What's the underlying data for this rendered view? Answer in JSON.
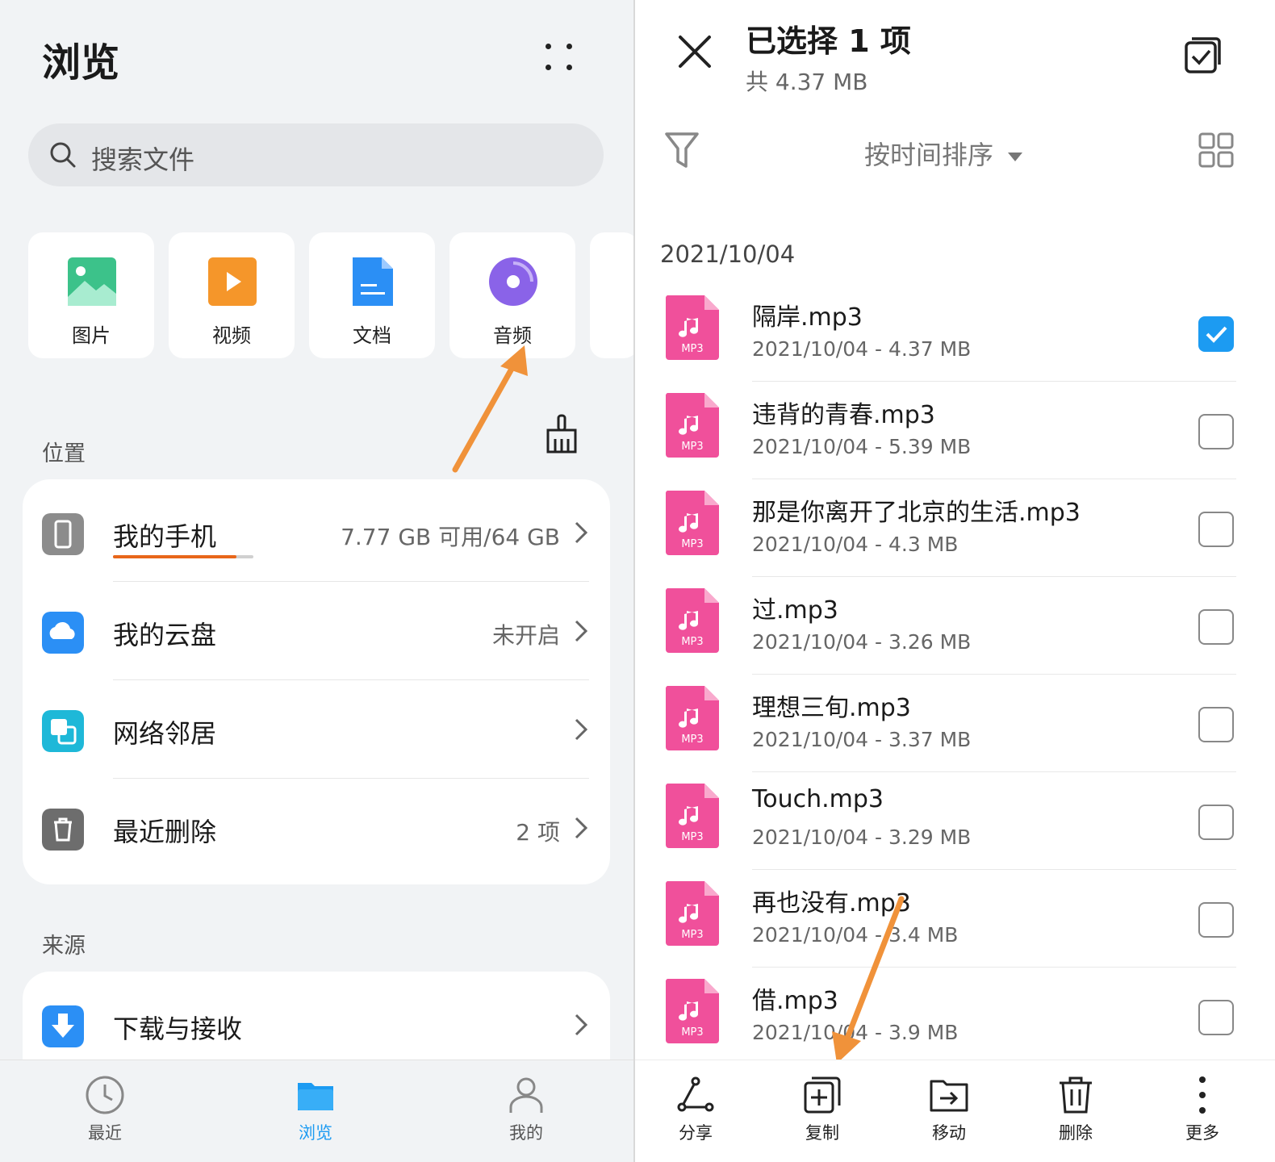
{
  "left": {
    "title": "浏览",
    "search_placeholder": "搜索文件",
    "categories": [
      {
        "label": "图片",
        "icon": "image-icon",
        "color": "#3cc28a"
      },
      {
        "label": "视频",
        "icon": "video-icon",
        "color": "#f5962a"
      },
      {
        "label": "文档",
        "icon": "document-icon",
        "color": "#2b8ff5"
      },
      {
        "label": "音频",
        "icon": "audio-icon",
        "color": "#8a63e8"
      }
    ],
    "location_header": "位置",
    "locations": [
      {
        "name": "我的手机",
        "value": "7.77 GB 可用/64 GB",
        "icon": "phone-icon",
        "storage_used_fraction": 0.88
      },
      {
        "name": "我的云盘",
        "value": "未开启",
        "icon": "cloud-icon"
      },
      {
        "name": "网络邻居",
        "value": "",
        "icon": "network-icon"
      },
      {
        "name": "最近删除",
        "value": "2 项",
        "icon": "trash-icon"
      }
    ],
    "source_header": "来源",
    "sources": [
      {
        "name": "下载与接收",
        "icon": "download-icon"
      }
    ],
    "bottom_nav": [
      {
        "label": "最近",
        "icon": "clock-icon",
        "active": false
      },
      {
        "label": "浏览",
        "icon": "folder-icon",
        "active": true
      },
      {
        "label": "我的",
        "icon": "person-icon",
        "active": false
      }
    ],
    "accent": "#1c9bf2",
    "annotation_color": "#f0923a"
  },
  "right": {
    "title": "已选择 1 项",
    "subtitle": "共 4.37 MB",
    "sort_label": "按时间排序",
    "date_group": "2021/10/04",
    "files": [
      {
        "name": "隔岸.mp3",
        "meta": "2021/10/04 - 4.37 MB",
        "checked": true
      },
      {
        "name": "违背的青春.mp3",
        "meta": "2021/10/04 - 5.39 MB",
        "checked": false
      },
      {
        "name": "那是你离开了北京的生活.mp3",
        "meta": "2021/10/04 - 4.3 MB",
        "checked": false
      },
      {
        "name": "过.mp3",
        "meta": "2021/10/04 - 3.26 MB",
        "checked": false
      },
      {
        "name": "理想三旬.mp3",
        "meta": "2021/10/04 - 3.37 MB",
        "checked": false
      },
      {
        "name": "Touch.mp3",
        "meta": "2021/10/04 - 3.29 MB",
        "checked": false
      },
      {
        "name": "再也没有.mp3",
        "meta": "2021/10/04 - 3.4 MB",
        "checked": false
      },
      {
        "name": "借.mp3",
        "meta": "2021/10/04 - 3.9 MB",
        "checked": false
      }
    ],
    "file_badge": "MP3",
    "toolbar": [
      {
        "label": "分享",
        "icon": "share-icon"
      },
      {
        "label": "复制",
        "icon": "copy-icon"
      },
      {
        "label": "移动",
        "icon": "move-icon"
      },
      {
        "label": "删除",
        "icon": "delete-icon"
      },
      {
        "label": "更多",
        "icon": "more-vertical-icon"
      }
    ],
    "mp3_color": "#f0509b",
    "check_color": "#1c9bf2"
  }
}
